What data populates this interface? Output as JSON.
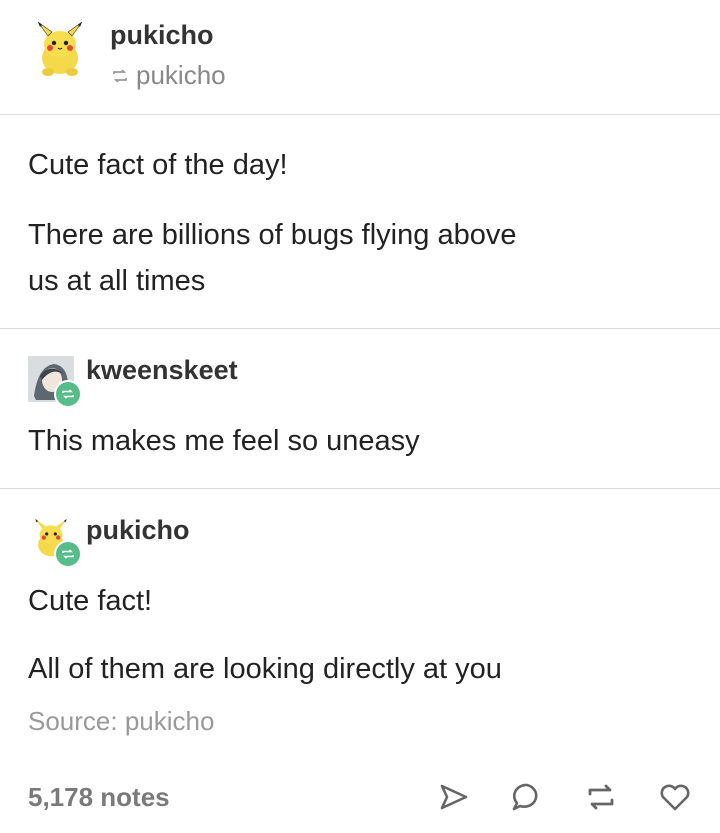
{
  "op": {
    "name": "pukicho",
    "via": "pukicho",
    "avatar_icon": "pikachu-plush-icon",
    "reblog_icon": "reblog-icon"
  },
  "post": {
    "line1": "Cute fact of the day!",
    "line2a": "There are billions of bugs flying above",
    "line2b": "us at all times"
  },
  "reblogs": [
    {
      "name": "kweenskeet",
      "text": "This makes me feel so uneasy",
      "avatar_icon": "anime-character-avatar-icon"
    },
    {
      "name": "pukicho",
      "text1": "Cute fact!",
      "text2": "All of them are looking directly at you",
      "avatar_icon": "pikachu-plush-icon"
    }
  ],
  "source": "Source: pukicho",
  "footer": {
    "notes": "5,178 notes",
    "actions": [
      "share-icon",
      "reply-icon",
      "reblog-icon",
      "like-icon"
    ]
  },
  "colors": {
    "reblog_badge": "#56bc8a",
    "divider": "#dcdcdc",
    "muted": "#999999"
  }
}
